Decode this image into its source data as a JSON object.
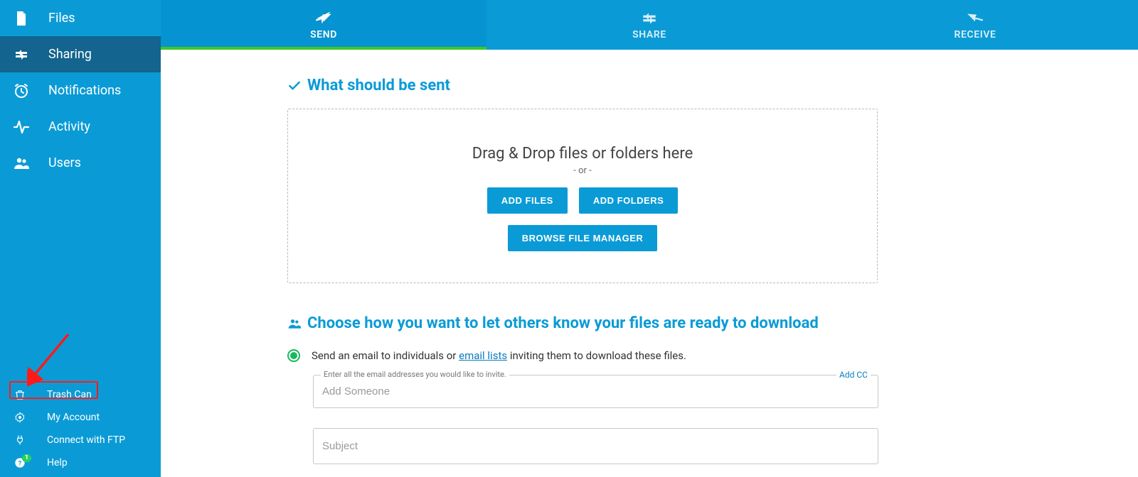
{
  "sidebar": {
    "primary": [
      {
        "label": "Files",
        "icon": "file"
      },
      {
        "label": "Sharing",
        "icon": "share",
        "active": true
      },
      {
        "label": "Notifications",
        "icon": "clock"
      },
      {
        "label": "Activity",
        "icon": "activity"
      },
      {
        "label": "Users",
        "icon": "users"
      }
    ],
    "secondary": [
      {
        "label": "Trash Can",
        "icon": "trash"
      },
      {
        "label": "My Account",
        "icon": "gear"
      },
      {
        "label": "Connect with FTP",
        "icon": "plug"
      },
      {
        "label": "Help",
        "icon": "help",
        "badge": "1"
      }
    ]
  },
  "tabs": [
    {
      "label": "SEND",
      "active": true
    },
    {
      "label": "SHARE",
      "active": false
    },
    {
      "label": "RECEIVE",
      "active": false
    }
  ],
  "section1": {
    "heading": "What should be sent",
    "dropzone": {
      "title": "Drag & Drop files or folders here",
      "or": "- or -",
      "add_files": "ADD FILES",
      "add_folders": "ADD FOLDERS",
      "browse": "BROWSE FILE MANAGER"
    }
  },
  "section2": {
    "heading": "Choose how you want to let others know your files are ready to download",
    "option_prefix": "Send an email to individuals or ",
    "option_link": "email lists",
    "option_suffix": " inviting them to download these files.",
    "email_field": {
      "legend": "Enter all the email addresses you would like to invite.",
      "placeholder": "Add Someone",
      "add_cc": "Add CC"
    },
    "subject_placeholder": "Subject"
  },
  "annotations": {
    "highlight_target": "Trash Can"
  }
}
